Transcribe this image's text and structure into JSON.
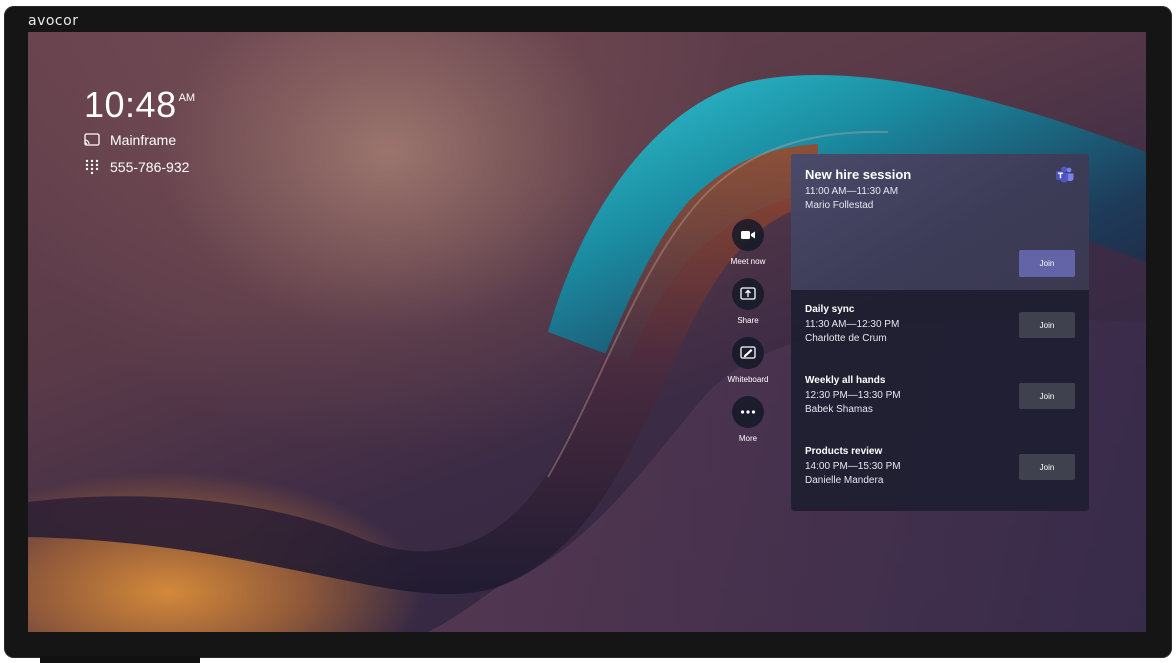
{
  "device": {
    "brand": "avocor"
  },
  "clock": {
    "time": "10:48",
    "ampm": "AM"
  },
  "room": {
    "name": "Mainframe",
    "icon": "cast-icon"
  },
  "phone": {
    "number": "555-786-932",
    "icon": "dialpad-icon"
  },
  "actions": [
    {
      "label": "Meet now",
      "icon": "video-camera-icon"
    },
    {
      "label": "Share",
      "icon": "share-screen-icon"
    },
    {
      "label": "Whiteboard",
      "icon": "whiteboard-icon"
    },
    {
      "label": "More",
      "icon": "more-icon"
    }
  ],
  "featured_meeting": {
    "title": "New hire session",
    "time": "11:00 AM—11:30 AM",
    "host": "Mario Follestad",
    "join_label": "Join",
    "icon": "teams-icon"
  },
  "meetings": [
    {
      "title": "Daily sync",
      "time": "11:30 AM—12:30 PM",
      "host": "Charlotte de Crum",
      "join_label": "Join"
    },
    {
      "title": "Weekly all hands",
      "time": "12:30 PM—13:30 PM",
      "host": "Babek Shamas",
      "join_label": "Join"
    },
    {
      "title": "Products review",
      "time": "14:00 PM—15:30 PM",
      "host": "Danielle Mandera",
      "join_label": "Join"
    }
  ],
  "colors": {
    "accent": "#6264a7",
    "panel": "#1c1e30",
    "wallpaper_teal": "#1fb8c8",
    "wallpaper_orange": "#d4893a"
  }
}
